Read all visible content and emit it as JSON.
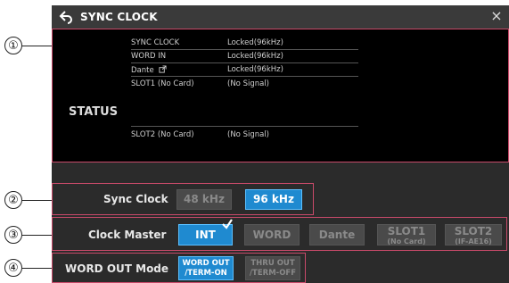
{
  "callouts": [
    "①",
    "②",
    "③",
    "④"
  ],
  "window": {
    "title": "SYNC CLOCK",
    "close_glyph": "×"
  },
  "status": {
    "label": "STATUS",
    "rows": [
      {
        "key": "SYNC CLOCK",
        "value": "Locked(96kHz)"
      },
      {
        "key": "WORD IN",
        "value": "Locked(96kHz)"
      },
      {
        "key": "Dante",
        "value": "Locked(96kHz)"
      },
      {
        "key": "SLOT1 (No Card)",
        "value": "(No Signal)"
      },
      {
        "key": "SLOT2 (No Card)",
        "value": "(No Signal)"
      }
    ]
  },
  "sync_clock": {
    "label": "Sync Clock",
    "options": [
      "48 kHz",
      "96 kHz"
    ],
    "selected": "96 kHz"
  },
  "clock_master": {
    "label": "Clock Master",
    "options": [
      {
        "main": "INT",
        "sub": ""
      },
      {
        "main": "WORD",
        "sub": ""
      },
      {
        "main": "Dante",
        "sub": ""
      },
      {
        "main": "SLOT1",
        "sub": "(No Card)"
      },
      {
        "main": "SLOT2",
        "sub": "(IF-AE16)"
      }
    ],
    "selected": "INT"
  },
  "word_out": {
    "label": "WORD OUT Mode",
    "options": [
      {
        "line1": "WORD OUT",
        "line2": "/TERM-ON"
      },
      {
        "line1": "THRU OUT",
        "line2": "/TERM-OFF"
      }
    ],
    "selected": "WORD OUT/TERM-ON"
  },
  "colors": {
    "accent": "#1f8ad0",
    "highlight_border": "#c94a6a",
    "panel": "#2b2b2b"
  },
  "icons": [
    "back-arrow-icon",
    "close-icon",
    "external-link-icon",
    "checkmark-icon"
  ]
}
